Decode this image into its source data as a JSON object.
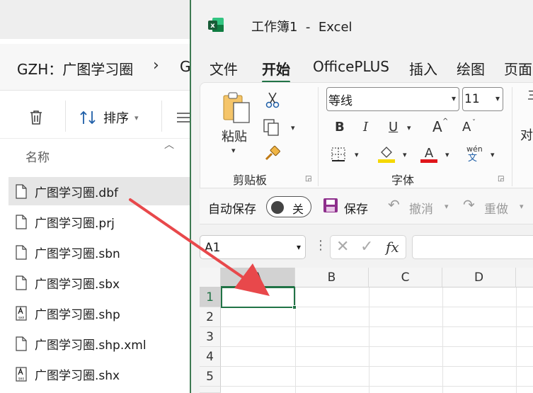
{
  "explorer": {
    "breadcrumb": [
      "GZH：广图学习圈",
      "G"
    ],
    "breadcrumb_sep": "›",
    "sort_label": "排序",
    "column_header": "名称",
    "files": [
      {
        "name": "广图学习圈.dbf",
        "icon": "document-icon",
        "selected": true
      },
      {
        "name": "广图学习圈.prj",
        "icon": "document-icon"
      },
      {
        "name": "广图学习圈.sbn",
        "icon": "document-icon"
      },
      {
        "name": "广图学习圈.sbx",
        "icon": "document-icon"
      },
      {
        "name": "广图学习圈.shp",
        "icon": "shp-file-icon",
        "badge": "SHP"
      },
      {
        "name": "广图学习圈.shp.xml",
        "icon": "document-icon"
      },
      {
        "name": "广图学习圈.shx",
        "icon": "shx-file-icon",
        "badge": "SHX"
      }
    ]
  },
  "excel": {
    "title": "工作簿1  -  Excel",
    "logo_letter": "x",
    "tabs": [
      "文件",
      "开始",
      "OfficePLUS",
      "插入",
      "绘图",
      "页面"
    ],
    "active_tab": "开始",
    "ribbon": {
      "clipboard": {
        "paste_label": "粘贴",
        "group_label": "剪贴板"
      },
      "font": {
        "font_name": "等线",
        "font_size": "11",
        "group_label": "字体",
        "bold": "B",
        "italic": "I",
        "underline": "U",
        "grow": "A",
        "shrink": "A",
        "wen_top": "wén",
        "wen_bottom": "文"
      },
      "align_partial": "对",
      "align_partial_top": "三"
    },
    "qat": {
      "autosave_label": "自动保存",
      "autosave_state": "关",
      "save_label": "保存",
      "undo_label": "撤消",
      "redo_label": "重做"
    },
    "formula_bar": {
      "name_box": "A1",
      "fx": "fx"
    },
    "columns": [
      "A",
      "B",
      "C",
      "D"
    ],
    "rows": [
      "1",
      "2",
      "3",
      "4",
      "5"
    ],
    "active_cell": "A1"
  },
  "colors": {
    "excel_green": "#217346",
    "annotation_arrow": "#e8484b",
    "fill_yellow": "#f5d800",
    "font_red": "#e0161b"
  }
}
